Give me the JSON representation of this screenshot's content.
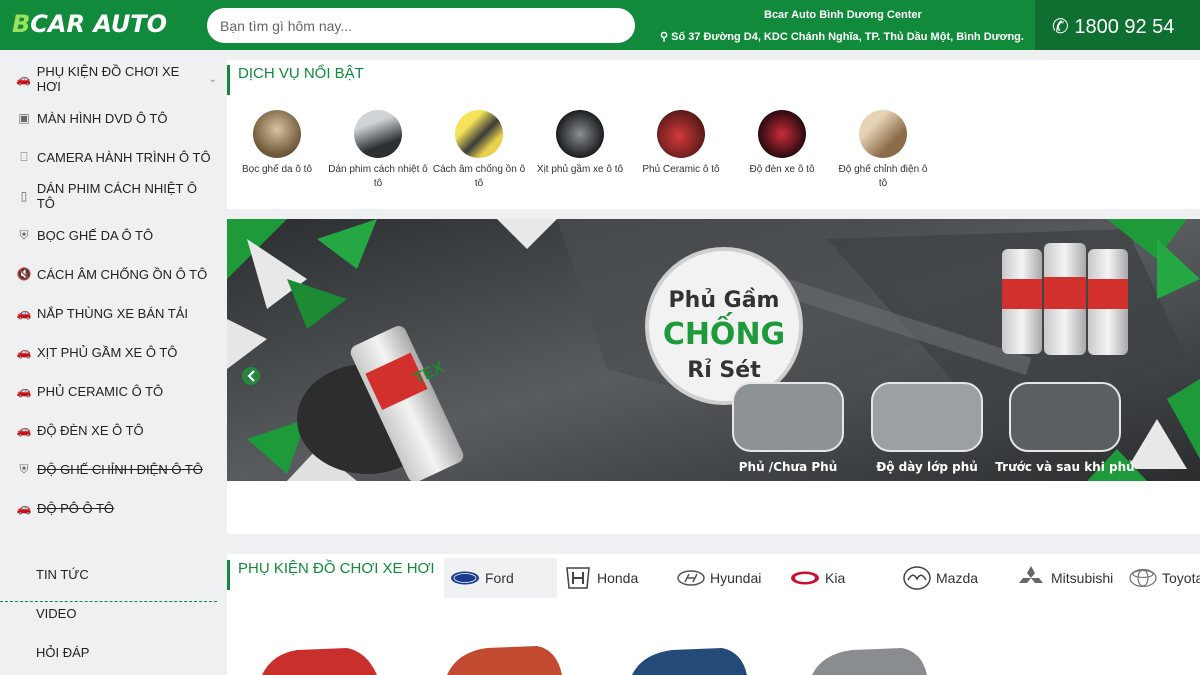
{
  "header": {
    "logo_prefix": "B",
    "logo_rest": "CAR AUTO",
    "search_placeholder": "Bạn tìm gì hôm nay...",
    "center_name": "Bcar Auto Bình Dương Center",
    "center_address": "Số 37 Đường D4, KDC Chánh Nghĩa, TP. Thủ Dầu Một, Bình Dương.",
    "phone": "1800 92 54",
    "brand_color": "#118a3c"
  },
  "sidebar": {
    "categories": [
      {
        "label": "PHỤ KIỆN ĐỒ CHƠI XE HƠI",
        "icon": "car-icon"
      },
      {
        "label": "MÀN HÌNH DVD Ô TÔ",
        "icon": "screen-icon"
      },
      {
        "label": "CAMERA HÀNH TRÌNH Ô TÔ",
        "icon": "camera-icon"
      },
      {
        "label": "DÁN PHIM CÁCH NHIỆT Ô TÔ",
        "icon": "film-icon"
      },
      {
        "label": "BỌC GHẾ DA Ô TÔ",
        "icon": "seat-icon"
      },
      {
        "label": "CÁCH ÂM CHỐNG ỒN Ô TÔ",
        "icon": "mute-icon"
      },
      {
        "label": "NẮP THÙNG XE BÁN TẢI",
        "icon": "car-icon"
      },
      {
        "label": "XỊT PHỦ GẦM XE Ô TÔ",
        "icon": "car-icon"
      },
      {
        "label": "PHỦ CERAMIC Ô TÔ",
        "icon": "car-icon"
      },
      {
        "label": "ĐỘ ĐÈN XE Ô TÔ",
        "icon": "car-icon"
      },
      {
        "label": "ĐỘ GHẾ CHỈNH ĐIỆN Ô TÔ",
        "icon": "seat-icon"
      },
      {
        "label": "ĐỘ PÔ Ô TÔ",
        "icon": "car-icon"
      }
    ],
    "links": [
      "TIN TỨC",
      "VIDEO",
      "HỎI ĐÁP"
    ]
  },
  "featured": {
    "title": "DỊCH VỤ NỔI BẬT",
    "services": [
      {
        "label": "Bọc ghế da ô tô"
      },
      {
        "label": "Dán phim cách nhiệt ô tô"
      },
      {
        "label": "Cách âm chống ồn ô tô"
      },
      {
        "label": "Xịt phủ gầm xe ô tô"
      },
      {
        "label": "Phủ Ceramic ô tô"
      },
      {
        "label": "Độ đèn xe ô tô"
      },
      {
        "label": "Độ ghế chỉnh điện ô tô"
      }
    ]
  },
  "banner": {
    "line1": "Phủ Gầm",
    "line2": "CHỐNG",
    "line3": "Rỉ Sét",
    "product_text": "TEX",
    "thumbs": [
      "Phủ /Chưa Phủ",
      "Độ dày lớp phủ",
      "Trước và sau khi phủ"
    ]
  },
  "accessories": {
    "title": "PHỤ KIỆN ĐỒ CHƠI XE HƠI",
    "brands": [
      {
        "label": "Ford",
        "icon": "ford-logo-icon"
      },
      {
        "label": "Honda",
        "icon": "honda-logo-icon"
      },
      {
        "label": "Hyundai",
        "icon": "hyundai-logo-icon"
      },
      {
        "label": "Kia",
        "icon": "kia-logo-icon"
      },
      {
        "label": "Mazda",
        "icon": "mazda-logo-icon"
      },
      {
        "label": "Mitsubishi",
        "icon": "mitsubishi-logo-icon"
      },
      {
        "label": "Toyota",
        "icon": "toyota-logo-icon"
      }
    ]
  }
}
